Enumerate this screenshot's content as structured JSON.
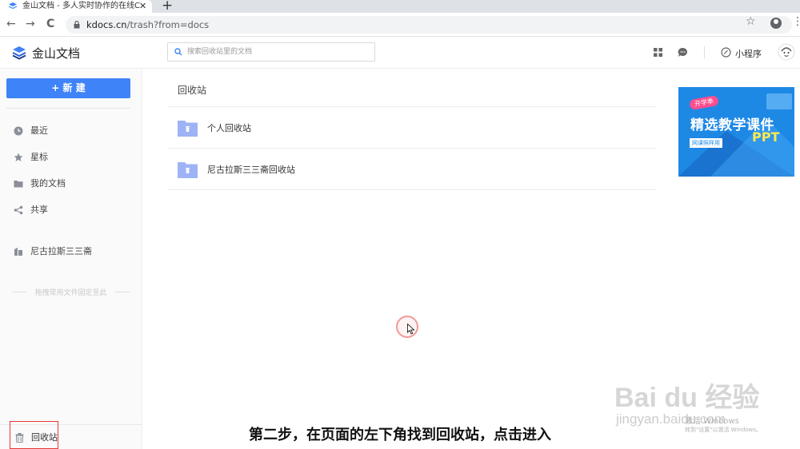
{
  "browser": {
    "tab_title": "金山文档 - 多人实时协作的在线C",
    "url_host": "kdocs.cn",
    "url_path": "/trash?from=docs",
    "close_glyph": "✕",
    "new_tab_glyph": "+",
    "back_glyph": "←",
    "forward_glyph": "→",
    "reload_glyph": "C",
    "star_glyph": "☆",
    "menu_glyph": "⋮"
  },
  "header": {
    "logo_text": "金山文档",
    "search_placeholder": "搜索回收站里的文档",
    "mini_program": "小程序"
  },
  "sidebar": {
    "new_button": "+ 新 建",
    "items": [
      {
        "label": "最近",
        "icon": "clock-icon"
      },
      {
        "label": "星标",
        "icon": "star-icon"
      },
      {
        "label": "我的文档",
        "icon": "folder-icon"
      },
      {
        "label": "共享",
        "icon": "share-icon"
      }
    ],
    "team": "尼古拉斯三三斋",
    "pin_hint": "拖拽常用文件固定至此",
    "trash": "回收站"
  },
  "main": {
    "title": "回收站",
    "rows": [
      {
        "label": "个人回收站"
      },
      {
        "label": "尼古拉斯三三斋回收站"
      }
    ]
  },
  "ad": {
    "badge": "开学季",
    "title": "精选教学课件",
    "ppt": "PPT",
    "sub": "网课照样用"
  },
  "overlay": {
    "subtitle": "第二步，在页面的左下角找到回收站，点击进入",
    "watermark": "Bai du 经验",
    "watermark_url": "jingyan.baidu.com",
    "activate_title": "激活 Windows",
    "activate_sub": "转到\"设置\"以激活 Windows。"
  },
  "colors": {
    "accent": "#3f83f8",
    "folder": "#9db3f5",
    "highlight_box": "#e53935"
  }
}
